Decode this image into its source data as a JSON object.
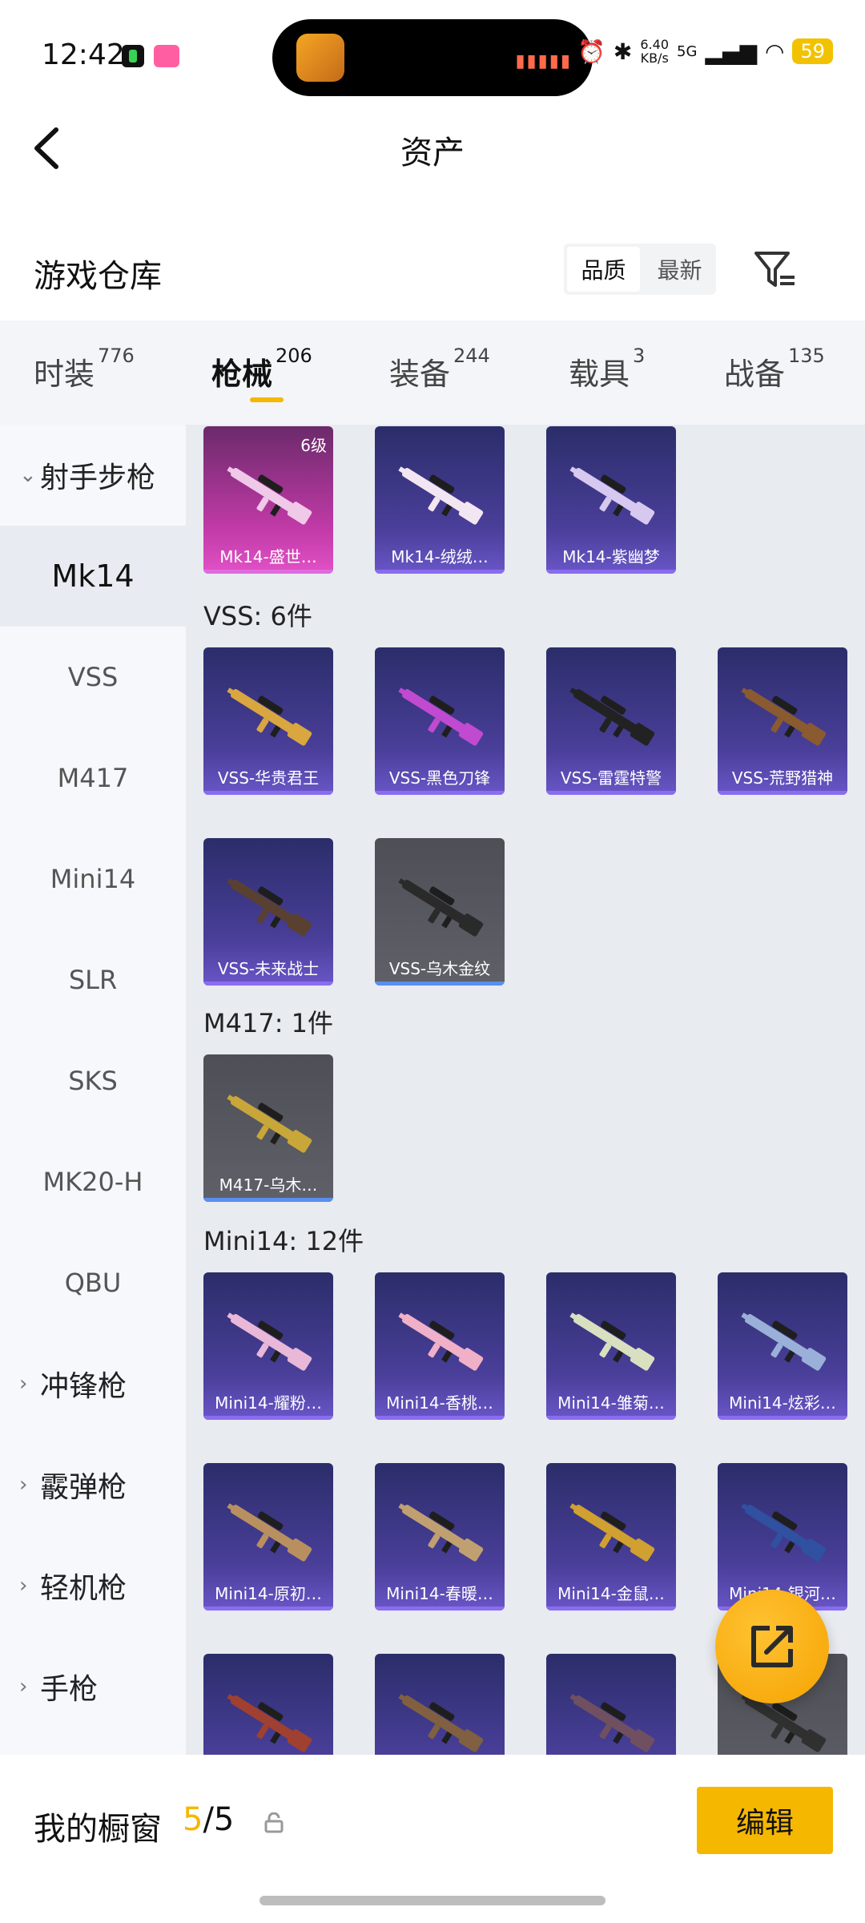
{
  "status": {
    "time": "12:42",
    "net_speed_top": "6.40",
    "net_speed_unit": "KB/s",
    "signal_label": "5G",
    "battery": "59"
  },
  "header": {
    "title": "资产"
  },
  "section": {
    "title": "游戏仓库",
    "sort_options": [
      "品质",
      "最新"
    ]
  },
  "tabs": [
    {
      "label": "时装",
      "count": "776"
    },
    {
      "label": "枪械",
      "count": "206"
    },
    {
      "label": "装备",
      "count": "244"
    },
    {
      "label": "载具",
      "count": "3"
    },
    {
      "label": "战备",
      "count": "135"
    }
  ],
  "sidebar": {
    "items": [
      {
        "label": "射手步枪"
      },
      {
        "label": "Mk14"
      },
      {
        "label": "VSS"
      },
      {
        "label": "M417"
      },
      {
        "label": "Mini14"
      },
      {
        "label": "SLR"
      },
      {
        "label": "SKS"
      },
      {
        "label": "MK20-H"
      },
      {
        "label": "QBU"
      },
      {
        "label": "冲锋枪"
      },
      {
        "label": "霰弹枪"
      },
      {
        "label": "轻机枪"
      },
      {
        "label": "手枪"
      }
    ]
  },
  "groups": {
    "mk14": {
      "items": [
        {
          "name": "Mk14-盛世…",
          "badge": "6级",
          "rarity": "pink",
          "gun_color": "#f0c8e8"
        },
        {
          "name": "Mk14-绒绒…",
          "rarity": "purple",
          "gun_color": "#f2e6f2"
        },
        {
          "name": "Mk14-紫幽梦",
          "rarity": "purple",
          "gun_color": "#d7c8f0"
        }
      ]
    },
    "vss": {
      "label": "VSS: 6件",
      "items": [
        {
          "name": "VSS-华贵君王",
          "rarity": "purple",
          "gun_color": "#d9a640"
        },
        {
          "name": "VSS-黑色刀锋",
          "rarity": "purple",
          "gun_color": "#c04ad0"
        },
        {
          "name": "VSS-雷霆特警",
          "rarity": "purple",
          "gun_color": "#222222"
        },
        {
          "name": "VSS-荒野猎神",
          "rarity": "purple",
          "gun_color": "#8a5a30"
        },
        {
          "name": "VSS-未来战士",
          "rarity": "purple",
          "gun_color": "#5a4030"
        },
        {
          "name": "VSS-乌木金纹",
          "rarity": "gray",
          "gun_color": "#2a2a2a"
        }
      ]
    },
    "m417": {
      "label": "M417: 1件",
      "items": [
        {
          "name": "M417-乌木…",
          "rarity": "gray",
          "gun_color": "#c9a63a"
        }
      ]
    },
    "mini14": {
      "label": "Mini14: 12件",
      "items": [
        {
          "name": "Mini14-耀粉…",
          "rarity": "purple",
          "gun_color": "#e9b8d8"
        },
        {
          "name": "Mini14-香桃…",
          "rarity": "purple",
          "gun_color": "#f0b0c8"
        },
        {
          "name": "Mini14-雏菊…",
          "rarity": "purple",
          "gun_color": "#d8e0c0"
        },
        {
          "name": "Mini14-炫彩…",
          "rarity": "purple",
          "gun_color": "#9ab0d8"
        },
        {
          "name": "Mini14-原初…",
          "rarity": "purple",
          "gun_color": "#b89060"
        },
        {
          "name": "Mini14-春暖…",
          "rarity": "purple",
          "gun_color": "#c0a070"
        },
        {
          "name": "Mini14-金鼠…",
          "rarity": "purple",
          "gun_color": "#d0a030"
        },
        {
          "name": "Mini14-银河…",
          "rarity": "purple",
          "gun_color": "#3050a0"
        },
        {
          "name": "",
          "rarity": "purple",
          "gun_color": "#a04030"
        },
        {
          "name": "",
          "rarity": "purple",
          "gun_color": "#806040"
        },
        {
          "name": "",
          "rarity": "purple",
          "gun_color": "#705060"
        },
        {
          "name": "",
          "rarity": "gray",
          "gun_color": "#303030"
        }
      ]
    }
  },
  "bottom": {
    "showcase_label": "我的橱窗",
    "showcase_current": "5",
    "showcase_sep_total": "/5",
    "edit_label": "编辑"
  },
  "colors": {
    "accent": "#f5b700",
    "rarity_purple": "#4a3f9a",
    "rarity_pink": "#c23aa8",
    "rarity_gray": "#5f6068"
  }
}
